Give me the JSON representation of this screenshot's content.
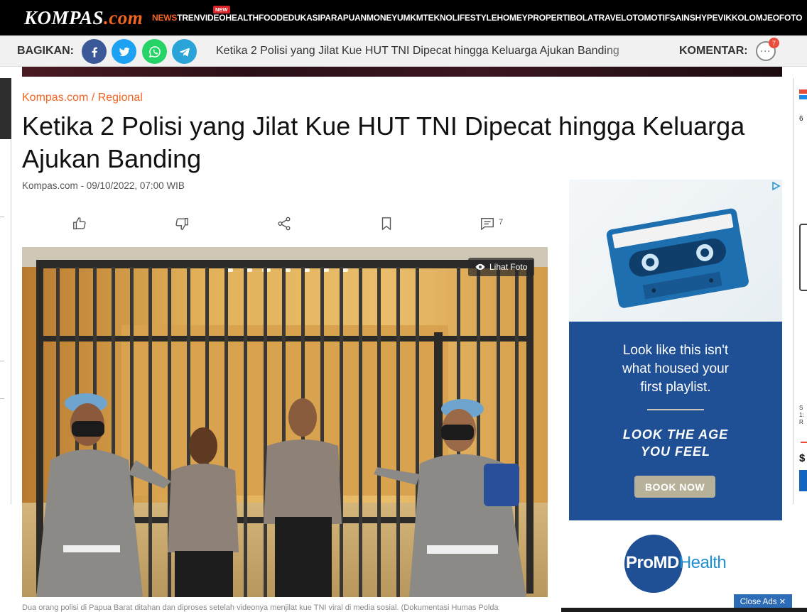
{
  "nav": {
    "logo": "KOMPAS",
    "logo_suffix": ".com",
    "new_badge": "NEW",
    "items": [
      "NEWS",
      "TREN",
      "VIDEO",
      "HEALTH",
      "FOOD",
      "EDUKASI",
      "PARAPUAN",
      "MONEY",
      "UMKM",
      "TEKNO",
      "LIFESTYLE",
      "HOMEY",
      "PROPERTI",
      "BOLA",
      "TRAVEL",
      "OTOMOTIF",
      "SAINS",
      "HYPE",
      "VIK",
      "KOLOM",
      "JEO",
      "FOTO"
    ],
    "active": "NEWS",
    "badge_on": "VIDEO"
  },
  "sharebar": {
    "share_label": "BAGIKAN:",
    "icons": [
      "facebook-icon",
      "twitter-icon",
      "whatsapp-icon",
      "telegram-icon"
    ],
    "icon_colors": {
      "facebook": "#3b5998",
      "twitter": "#1da1f2",
      "whatsapp": "#25d366",
      "telegram": "#2aa3d9"
    },
    "article_title": "Ketika 2 Polisi yang Jilat Kue HUT TNI Dipecat hingga Keluarga Ajukan Banding",
    "comment_label": "KOMENTAR:",
    "comment_count": "7"
  },
  "article": {
    "breadcrumb": "Kompas.com / Regional",
    "title": "Ketika 2 Polisi yang Jilat Kue HUT TNI Dipecat hingga Keluarga Ajukan Banding",
    "meta": "Kompas.com - 09/10/2022, 07:00 WIB",
    "comment_count": "7",
    "lihat_foto": "Lihat Foto",
    "caption": "Dua orang polisi di Papua Barat ditahan dan diproses setelah videonya menjilat kue TNI viral di media sosial. (Dokumentasi Humas Polda"
  },
  "ad": {
    "headline": [
      "Look like this isn't",
      "what housed your",
      "first playlist."
    ],
    "tagline": [
      "LOOK THE AGE",
      "YOU FEEL"
    ],
    "cta": "BOOK NOW",
    "brand": "ProMD",
    "brand_suffix": "Health",
    "close_label": "Close Ads ✕"
  },
  "side_right": {
    "snippet": "6",
    "small_text": [
      "S",
      "1:",
      "R"
    ],
    "price_symbol": "$"
  },
  "colors": {
    "accent": "#f26522",
    "nav_bg": "#000000",
    "ad_blue": "#1f4f94"
  }
}
